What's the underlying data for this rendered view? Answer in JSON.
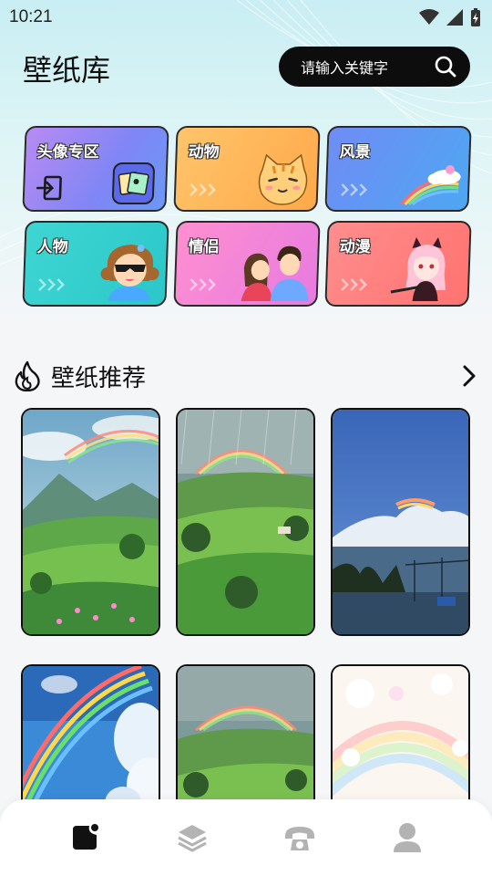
{
  "status_bar": {
    "time": "10:21"
  },
  "header": {
    "title": "壁纸库",
    "search_placeholder": "请输入关键字"
  },
  "categories": [
    {
      "label": "头像专区",
      "icon": "login-icon"
    },
    {
      "label": "动物",
      "icon": "cat-illustration"
    },
    {
      "label": "风景",
      "icon": "rainbow-illustration"
    },
    {
      "label": "人物",
      "icon": "girl-illustration"
    },
    {
      "label": "情侣",
      "icon": "couple-illustration"
    },
    {
      "label": "动漫",
      "icon": "anime-girl-illustration"
    }
  ],
  "recommend": {
    "title": "壁纸推荐",
    "icon": "flame-icon",
    "more_icon": "chevron-right-icon"
  },
  "wallpapers": [
    {
      "scene": "rainbow-valley"
    },
    {
      "scene": "rainbow-rain-fields"
    },
    {
      "scene": "rainbow-cloud-sky"
    },
    {
      "scene": "rainbow-blue-sky"
    },
    {
      "scene": "rainbow-rain-fields"
    },
    {
      "scene": "pastel-rainbow"
    }
  ],
  "bottom_nav": [
    {
      "icon": "wallpaper-icon",
      "active": true
    },
    {
      "icon": "layers-icon",
      "active": false
    },
    {
      "icon": "phone-icon",
      "active": false
    },
    {
      "icon": "user-icon",
      "active": false
    }
  ],
  "colors": {
    "accent": "#0d0d0d",
    "cat_avatar": "#8b7bf0",
    "cat_animal": "#ffb347",
    "cat_scenery": "#5b8ff0",
    "cat_people": "#2fd3cf",
    "cat_couple": "#f07bd0",
    "cat_anime": "#ff7b7b"
  }
}
